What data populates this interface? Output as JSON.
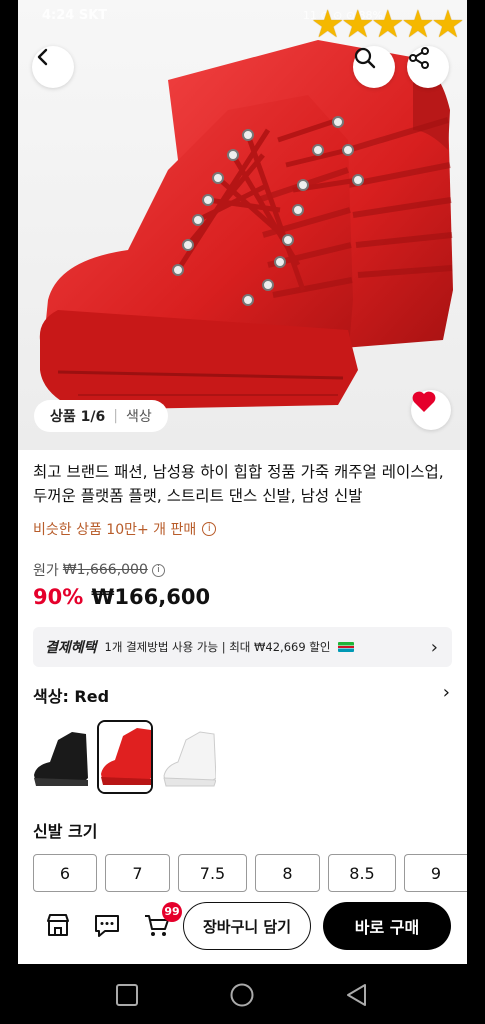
{
  "status_bar": {
    "time": "4:24 SKT",
    "right_text": "11 ⊙ ⊙ ⊙ 88%"
  },
  "rating": {
    "stars": "★★★★★",
    "value": 5,
    "max": 5
  },
  "gallery": {
    "counter": "상품 1/6",
    "option_label": "색상"
  },
  "product": {
    "title": "최고 브랜드 패션, 남성용 하이 힙합 정품 가죽 캐주얼 레이스업, 두꺼운 플랫폼 플랫, 스트리트 댄스 신발, 남성 신발",
    "similar_sales": "비슷한 상품 10만+ 개 판매",
    "info_glyph": "i",
    "original_label": "원가",
    "original_price": "₩1,666,000",
    "discount": "90%",
    "price": "₩166,600"
  },
  "benefit": {
    "title": "결제혜택",
    "text": "1개 결제방법 사용 가능 | 최대 ₩42,669 할인",
    "chevron": "›"
  },
  "color": {
    "label": "색상: Red",
    "chevron": "›",
    "swatches": [
      "Black",
      "Red",
      "White"
    ],
    "selected": "Red"
  },
  "size": {
    "label": "신발 크기",
    "options": [
      "6",
      "7",
      "7.5",
      "8",
      "8.5",
      "9"
    ]
  },
  "bottom_bar": {
    "cart_count": "99",
    "add_to_cart": "장바구니 담기",
    "buy_now": "바로 구매"
  },
  "colors": {
    "accent_red": "#e5002b",
    "shoe_red": "#e02020",
    "buy_bg": "#000000",
    "similar_text": "#b85c2a"
  }
}
